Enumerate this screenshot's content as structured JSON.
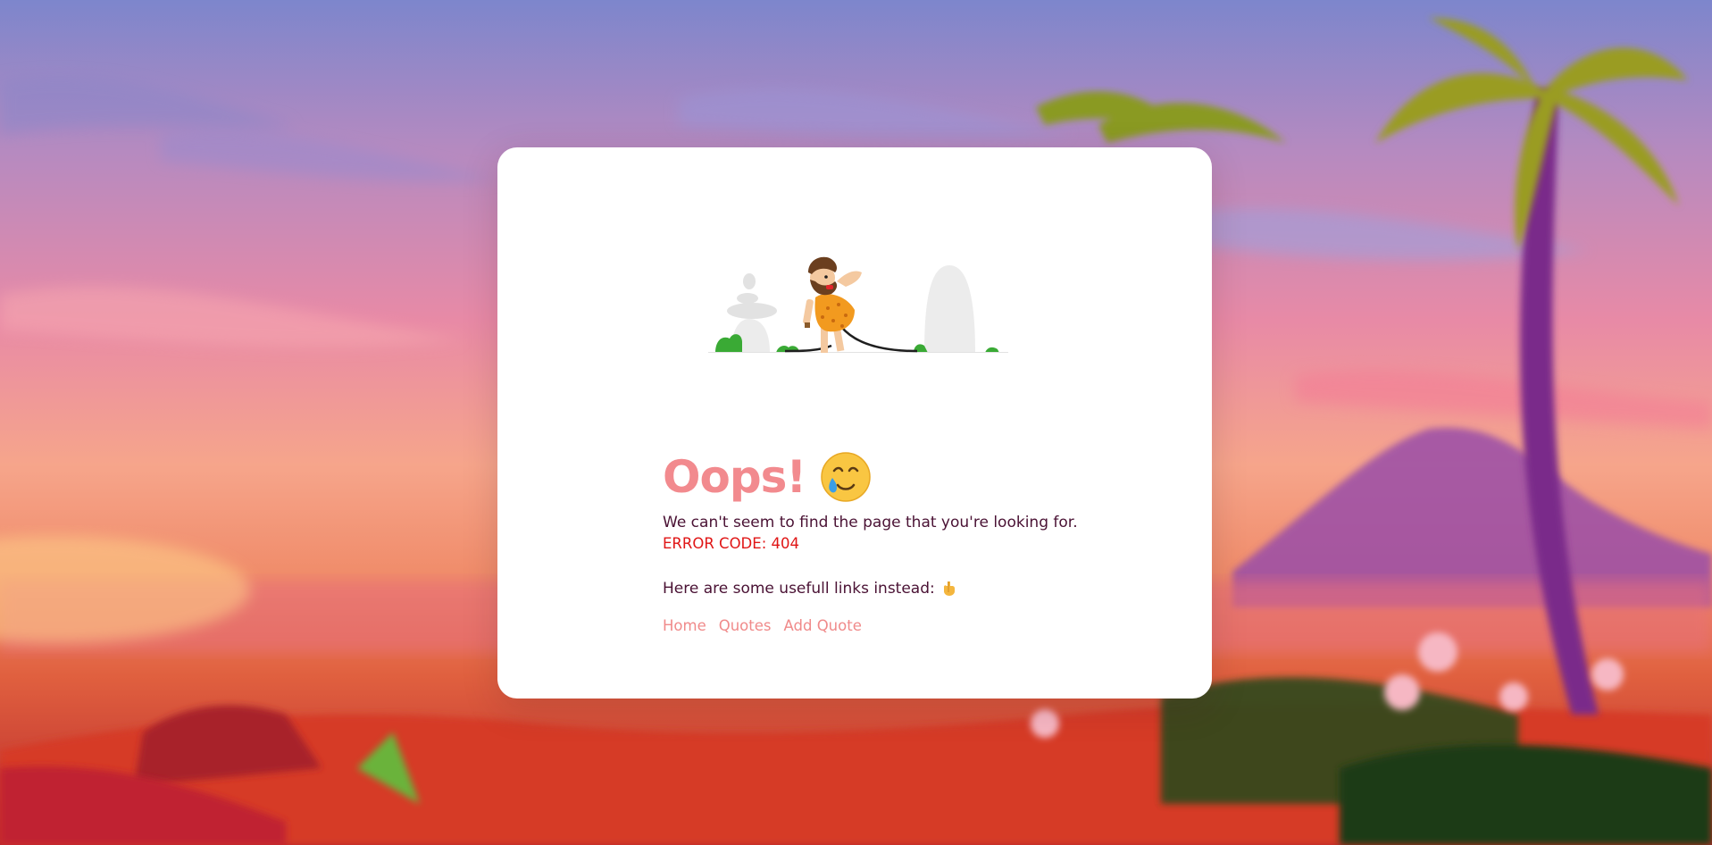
{
  "title": "Oops!",
  "message": "We can't seem to find the page that you're looking for.",
  "error_code": "ERROR CODE: 404",
  "links_intro": "Here are some usefull links instead:",
  "links": [
    {
      "label": "Home"
    },
    {
      "label": "Quotes"
    },
    {
      "label": "Add Quote"
    }
  ],
  "icons": {
    "title_emoji": "smiling-face-with-tear-icon",
    "links_emoji": "pointing-down-hand-icon"
  },
  "colors": {
    "title": "#f28a8e",
    "text": "#4a1234",
    "error": "#e01616",
    "link": "#f08a8a",
    "card": "#ffffff"
  }
}
